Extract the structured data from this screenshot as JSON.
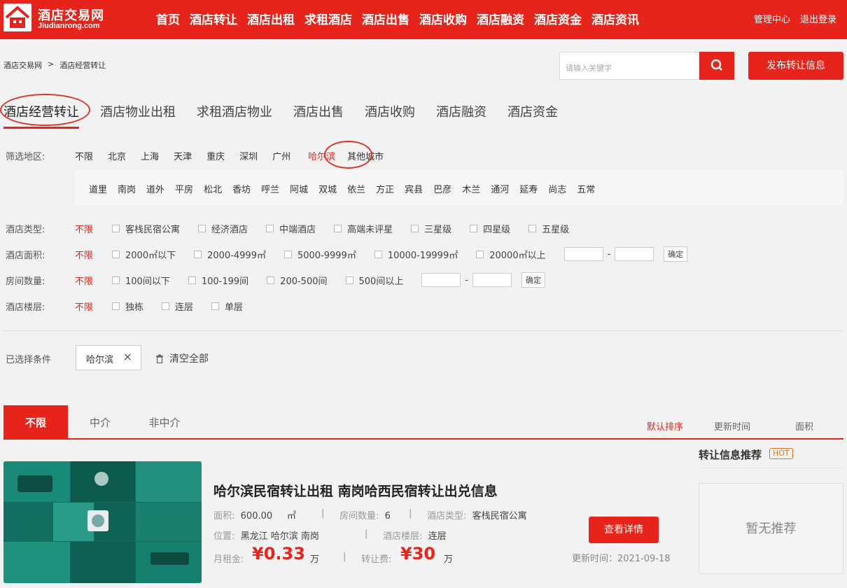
{
  "header": {
    "logo_cn": "酒店交易网",
    "logo_en": "Jiudianrong.com",
    "nav": [
      "首页",
      "酒店转让",
      "酒店出租",
      "求租酒店",
      "酒店出售",
      "酒店收购",
      "酒店融资",
      "酒店资金",
      "酒店资讯"
    ],
    "links": [
      "管理中心",
      "退出登录"
    ]
  },
  "breadcrumb": [
    "酒店交易网",
    ">",
    "酒店经营转让"
  ],
  "search": {
    "placeholder": "请输入关键字"
  },
  "publish_label": "发布转让信息",
  "tabs": [
    "酒店经营转让",
    "酒店物业出租",
    "求租酒店物业",
    "酒店出售",
    "酒店收购",
    "酒店融资",
    "酒店资金"
  ],
  "filters": {
    "region_label": "筛选地区:",
    "cities": [
      "不限",
      "北京",
      "上海",
      "天津",
      "重庆",
      "深圳",
      "广州",
      "哈尔滨",
      "其他城市"
    ],
    "districts": [
      "道里",
      "南岗",
      "道外",
      "平房",
      "松北",
      "香坊",
      "呼兰",
      "阿城",
      "双城",
      "依兰",
      "方正",
      "宾县",
      "巴彦",
      "木兰",
      "通河",
      "延寿",
      "尚志",
      "五常"
    ],
    "type": {
      "label": "酒店类型:",
      "any": "不限",
      "opts": [
        "客栈民宿公寓",
        "经济酒店",
        "中端酒店",
        "高端未评星",
        "三星级",
        "四星级",
        "五星级"
      ]
    },
    "area": {
      "label": "酒店面积:",
      "any": "不限",
      "opts": [
        "2000㎡以下",
        "2000-4999㎡",
        "5000-9999㎡",
        "10000-19999㎡",
        "20000㎡以上"
      ],
      "confirm": "确定"
    },
    "rooms": {
      "label": "房间数量:",
      "any": "不限",
      "opts": [
        "100间以下",
        "100-199间",
        "200-500间",
        "500间以上"
      ],
      "confirm": "确定"
    },
    "floor": {
      "label": "酒店楼层:",
      "any": "不限",
      "opts": [
        "独栋",
        "连层",
        "单层"
      ]
    },
    "selected_label": "已选择条件",
    "selected_tag": "哈尔滨",
    "clear_label": "清空全部"
  },
  "list_tabs": [
    "不限",
    "中介",
    "非中介"
  ],
  "sorts": [
    "默认排序",
    "更新时间",
    "面积"
  ],
  "listing": {
    "title": "哈尔滨民宿转让出租 南岗哈西民宿转让出兑信息",
    "area_label": "面积:",
    "area_value": "600.00",
    "area_unit": "㎡",
    "rooms_label": "房间数量:",
    "rooms_value": "6",
    "type_label": "酒店类型:",
    "type_value": "客栈民宿公寓",
    "location_label": "位置:",
    "location_value": "黑龙江 哈尔滨 南岗",
    "floor_label": "酒店楼层:",
    "floor_value": "连层",
    "rent_label": "月租金:",
    "rent_value": "¥0.33",
    "rent_unit": "万",
    "fee_label": "转让费:",
    "fee_value": "¥30",
    "fee_unit": "万",
    "sep": "|",
    "detail_label": "查看详情",
    "updated": "更新时间：2021-09-18"
  },
  "recommend": {
    "title": "转让信息推荐",
    "hot": "HOT",
    "empty": "暂无推荐"
  },
  "colors": {
    "brand": "#e7241b",
    "teal": "#1a8a78"
  }
}
